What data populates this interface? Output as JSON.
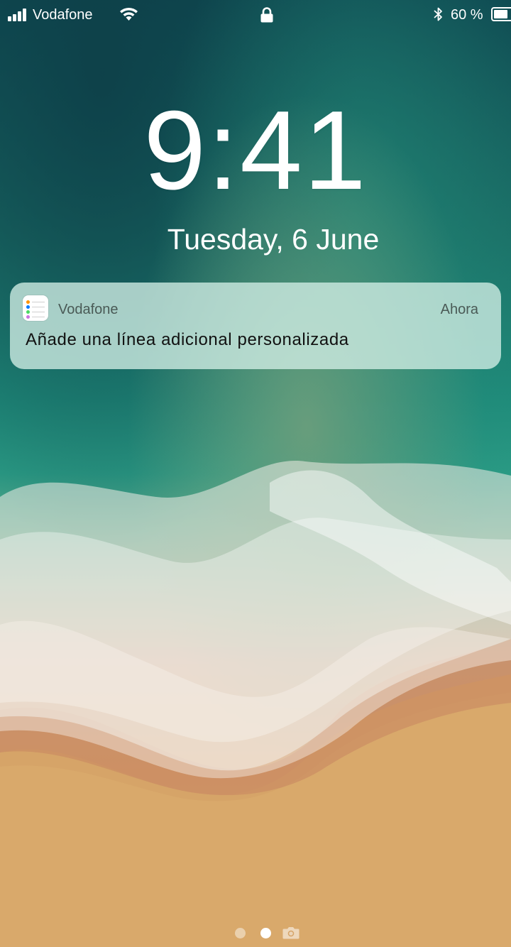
{
  "status_bar": {
    "carrier": "Vodafone",
    "battery_percent_label": "60 %",
    "battery_level": 0.6,
    "signal_bars": 4,
    "icons": [
      "signal-bars-icon",
      "wifi-icon",
      "lock-icon",
      "bluetooth-icon",
      "battery-icon"
    ]
  },
  "lock_screen": {
    "time": "9:41",
    "date": "Tuesday, 6 June"
  },
  "notification": {
    "app_name": "Vodafone",
    "time_label": "Ahora",
    "message": "Añade una línea adicional personalizada",
    "icon": "reminders-list-icon"
  },
  "page_indicator": {
    "pages": 2,
    "active_page": 1,
    "camera_icon": "camera-icon"
  },
  "colors": {
    "background_ocean": "#1c6b63",
    "background_sand": "#d4a064",
    "notification_bg": "#cde9e1"
  }
}
